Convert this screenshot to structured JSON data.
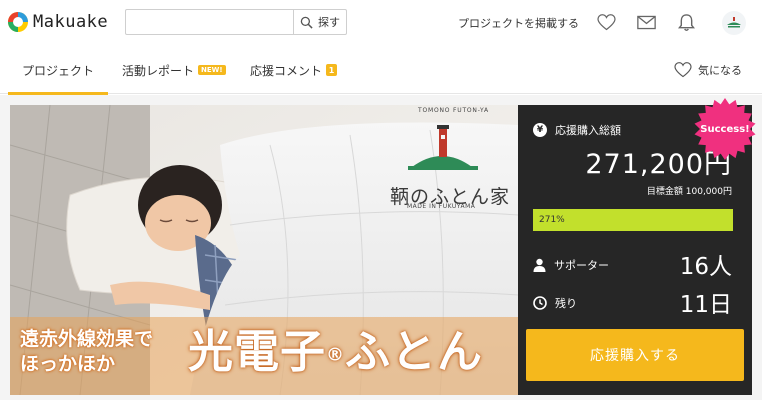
{
  "header": {
    "logo_text": "Makuake",
    "search": {
      "placeholder": "",
      "button_label": "探す"
    },
    "post_project_label": "プロジェクトを掲載する",
    "icons": [
      "heart-icon",
      "mail-icon",
      "bell-icon",
      "avatar"
    ]
  },
  "tabs": {
    "project_label": "プロジェクト",
    "report_label": "活動レポート",
    "report_badge": "NEW!",
    "comment_label": "応援コメント",
    "comment_count": "1",
    "favorite_label": "気になる"
  },
  "hero": {
    "brand_arc": "TOMONO FUTON-YA",
    "brand_name": "鞆のふとん家",
    "brand_made": "MADE IN FUKUYAMA",
    "subcopy_line1": "遠赤外線効果で",
    "subcopy_line2": "ほっかほか",
    "main_copy_a": "光電子",
    "main_copy_r": "®",
    "main_copy_b": "ふとん"
  },
  "funding": {
    "total_label": "応援購入総額",
    "amount": "271,200円",
    "goal": "目標金額 100,000円",
    "progress_text": "271%",
    "progress_percent": 271,
    "supporters_label": "サポーター",
    "supporters_value": "16人",
    "remaining_label": "残り",
    "remaining_value": "11日",
    "success_badge": "Success!",
    "buy_button": "応援購入する"
  },
  "colors": {
    "accent": "#f5b81c",
    "panel_bg": "#262626",
    "progress": "#c2e02c",
    "success_badge": "#f0307f"
  }
}
